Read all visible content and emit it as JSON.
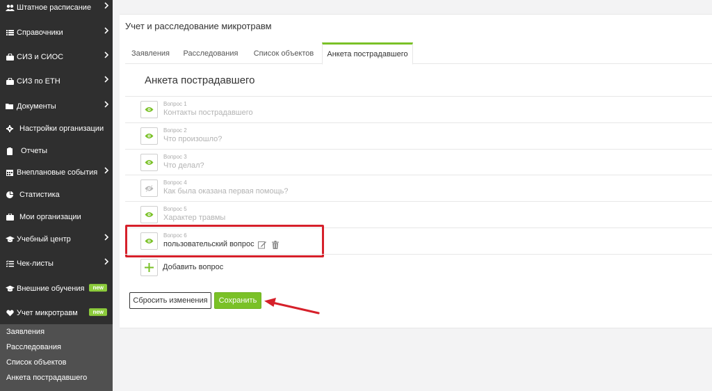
{
  "sidebar": {
    "items": [
      {
        "label": "Штатное расписание",
        "icon": "users-icon",
        "chevron": true
      },
      {
        "label": "Справочники",
        "icon": "list-icon",
        "chevron": true
      },
      {
        "label": "СИЗ и СИОС",
        "icon": "bag-icon",
        "chevron": true
      },
      {
        "label": "СИЗ по ЕТН",
        "icon": "bag-icon",
        "chevron": true
      },
      {
        "label": "Документы",
        "icon": "folder-icon",
        "chevron": true
      },
      {
        "label": "Настройки организации",
        "icon": "gear-icon",
        "chevron": false
      },
      {
        "label": "Отчеты",
        "icon": "clipboard-icon",
        "chevron": false
      },
      {
        "label": "Внеплановые события",
        "icon": "calendar-icon",
        "chevron": true
      },
      {
        "label": "Статистика",
        "icon": "pie-chart-icon",
        "chevron": false
      },
      {
        "label": "Мои организации",
        "icon": "briefcase-icon",
        "chevron": false
      },
      {
        "label": "Учебный центр",
        "icon": "graduation-cap-icon",
        "chevron": true
      },
      {
        "label": "Чек-листы",
        "icon": "checklist-icon",
        "chevron": true
      },
      {
        "label": "Внешние обучения",
        "icon": "graduation-cap-icon",
        "badge": "new"
      },
      {
        "label": "Учет микротравм",
        "icon": "heart-icon",
        "badge": "new"
      }
    ],
    "submenu": [
      "Заявления",
      "Расследования",
      "Список объектов",
      "Анкета пострадавшего"
    ]
  },
  "page": {
    "title": "Учет и расследование микротравм",
    "tabs": [
      "Заявления",
      "Расследования",
      "Список объектов",
      "Анкета пострадавшего"
    ],
    "active_tab": "Анкета пострадавшего",
    "section_title": "Анкета пострадавшего",
    "questions": [
      {
        "number": "Вопрос 1",
        "text": "Контакты пострадавшего",
        "visible": true
      },
      {
        "number": "Вопрос 2",
        "text": "Что произошло?",
        "visible": true
      },
      {
        "number": "Вопрос 3",
        "text": "Что делал?",
        "visible": true
      },
      {
        "number": "Вопрос 4",
        "text": "Как была оказана первая помощь?",
        "visible": false
      },
      {
        "number": "Вопрос 5",
        "text": "Характер травмы",
        "visible": true
      },
      {
        "number": "Вопрос 6",
        "text": "пользовательский вопрос",
        "visible": true,
        "custom": true
      }
    ],
    "add_question_label": "Добавить вопрос",
    "reset_label": "Сбросить изменения",
    "save_label": "Сохранить"
  },
  "colors": {
    "accent": "#7ac127",
    "sidebar_bg": "#2f2f2f",
    "submenu_bg": "#505050",
    "highlight": "#d6202a"
  }
}
